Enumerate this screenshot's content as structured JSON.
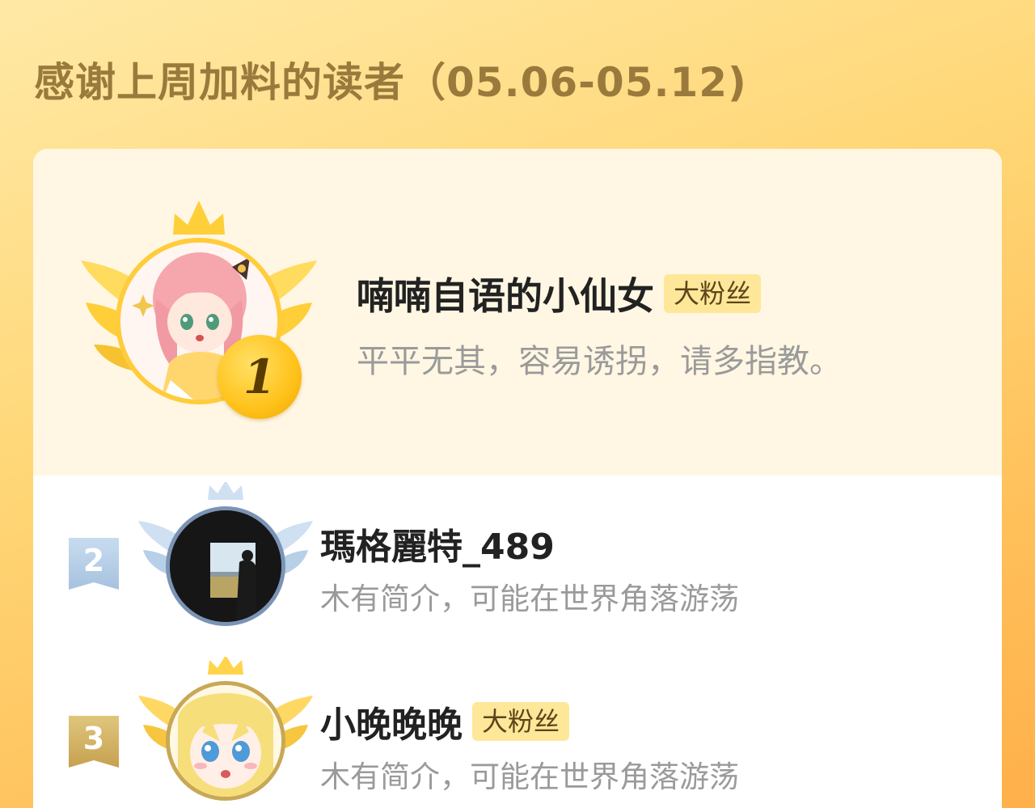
{
  "page": {
    "title": "感谢上周加料的读者（05.06-05.12)"
  },
  "readers": [
    {
      "rank": "1",
      "name": "喃喃自语的小仙女",
      "badge": "大粉丝",
      "bio": "平平无其，容易诱拐，请多指教。",
      "avatar_icon": "anime-girl-pink-hair-avatar",
      "frame_color": "#ffcc3c"
    },
    {
      "rank": "2",
      "name": "瑪格麗特_489",
      "badge": "",
      "bio": "木有简介，可能在世界角落游荡",
      "avatar_icon": "silhouette-window-avatar",
      "frame_color": "#7b94b5"
    },
    {
      "rank": "3",
      "name": "小晚晚晚",
      "badge": "大粉丝",
      "bio": "木有简介，可能在世界角落游荡",
      "avatar_icon": "anime-girl-blonde-avatar",
      "frame_color": "#c8a856"
    }
  ],
  "colors": {
    "background_top": "#ffe9a6",
    "background_bottom": "#ffb04a",
    "title": "#9a7a3c",
    "badge_bg": "#ffe79a",
    "gold_medal": "#ffc21a",
    "silver_flag": "#a6c2df",
    "bronze_flag": "#c6a14f"
  }
}
